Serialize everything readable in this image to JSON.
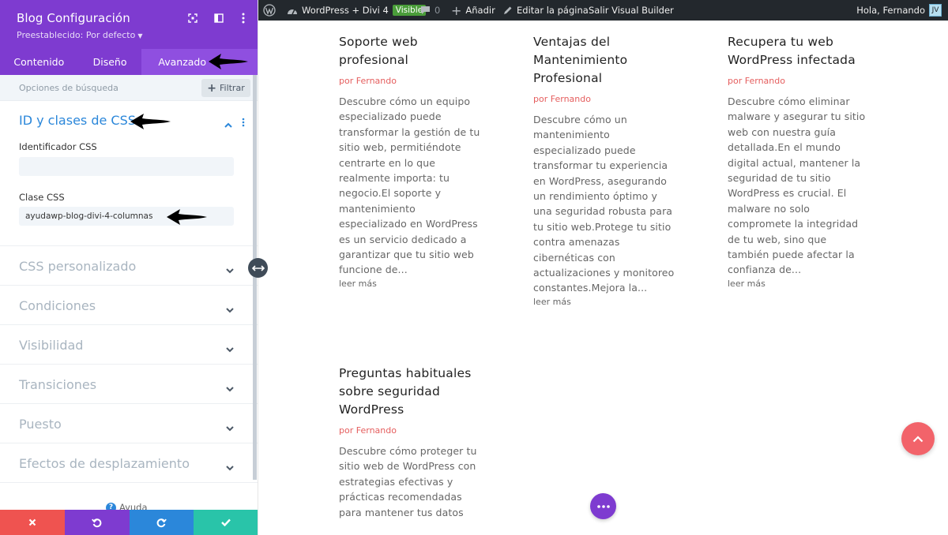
{
  "panel": {
    "title": "Blog Configuración",
    "preset": "Preestablecido: Por defecto",
    "tabs": [
      {
        "label": "Contenido"
      },
      {
        "label": "Diseño"
      },
      {
        "label": "Avanzado"
      }
    ],
    "search_placeholder": "Opciones de búsqueda",
    "filter_label": "Filtrar",
    "open_section": {
      "title": "ID y clases de CSS",
      "css_id_label": "Identificador CSS",
      "css_id_value": "",
      "css_class_label": "Clase CSS",
      "css_class_value": "ayudawp-blog-divi-4-columnas"
    },
    "sections": [
      {
        "label": "CSS personalizado"
      },
      {
        "label": "Condiciones"
      },
      {
        "label": "Visibilidad"
      },
      {
        "label": "Transiciones"
      },
      {
        "label": "Puesto"
      },
      {
        "label": "Efectos de desplazamiento"
      }
    ],
    "help_label": "Ayuda",
    "colors": {
      "header": "#7e3bd0",
      "cancel": "#ef5350",
      "undo": "#7e3bd0",
      "redo": "#2b87da",
      "save": "#29c4a9",
      "accent": "#2b87da"
    }
  },
  "adminbar": {
    "site_name": "WordPress + Divi 4",
    "visible_badge": "Visible",
    "comments_count": "0",
    "add_label": "Añadir",
    "edit_label": "Editar la página",
    "exit_label": "Salir Visual Builder",
    "greeting": "Hola, Fernando"
  },
  "posts": [
    {
      "title": "Soporte web profesional",
      "meta_prefix": "por",
      "author": "Fernando",
      "excerpt": "Descubre cómo un equipo especializado puede transformar la gestión de tu sitio web, permitiéndote centrarte en lo que realmente importa: tu negocio.El soporte y mantenimiento especializado en WordPress es un servicio dedicado a garantizar que tu sitio web funcione de...",
      "read_more": "leer más"
    },
    {
      "title": "Ventajas del Mantenimiento Profesional",
      "meta_prefix": "por",
      "author": "Fernando",
      "excerpt": "Descubre cómo un mantenimiento especializado puede transformar tu experiencia en WordPress, asegurando un rendimiento óptimo y una seguridad robusta para tu sitio web.Protege tu sitio contra amenazas cibernéticas con actualizaciones y monitoreo constantes.Mejora la...",
      "read_more": "leer más"
    },
    {
      "title": "Recupera tu web WordPress infectada",
      "meta_prefix": "por",
      "author": "Fernando",
      "excerpt": "Descubre cómo eliminar malware y asegurar tu sitio web con nuestra guía detallada.En el mundo digital actual, mantener la seguridad de tu sitio WordPress es crucial. El malware no solo compromete la integridad de tu web, sino que también puede afectar la confianza de...",
      "read_more": "leer más"
    },
    {
      "title": "Preguntas habituales sobre seguridad WordPress",
      "meta_prefix": "por",
      "author": "Fernando",
      "excerpt": "Descubre cómo proteger tu sitio web de WordPress con estrategias efectivas y prácticas recomendadas para mantener tus datos",
      "read_more": ""
    }
  ]
}
